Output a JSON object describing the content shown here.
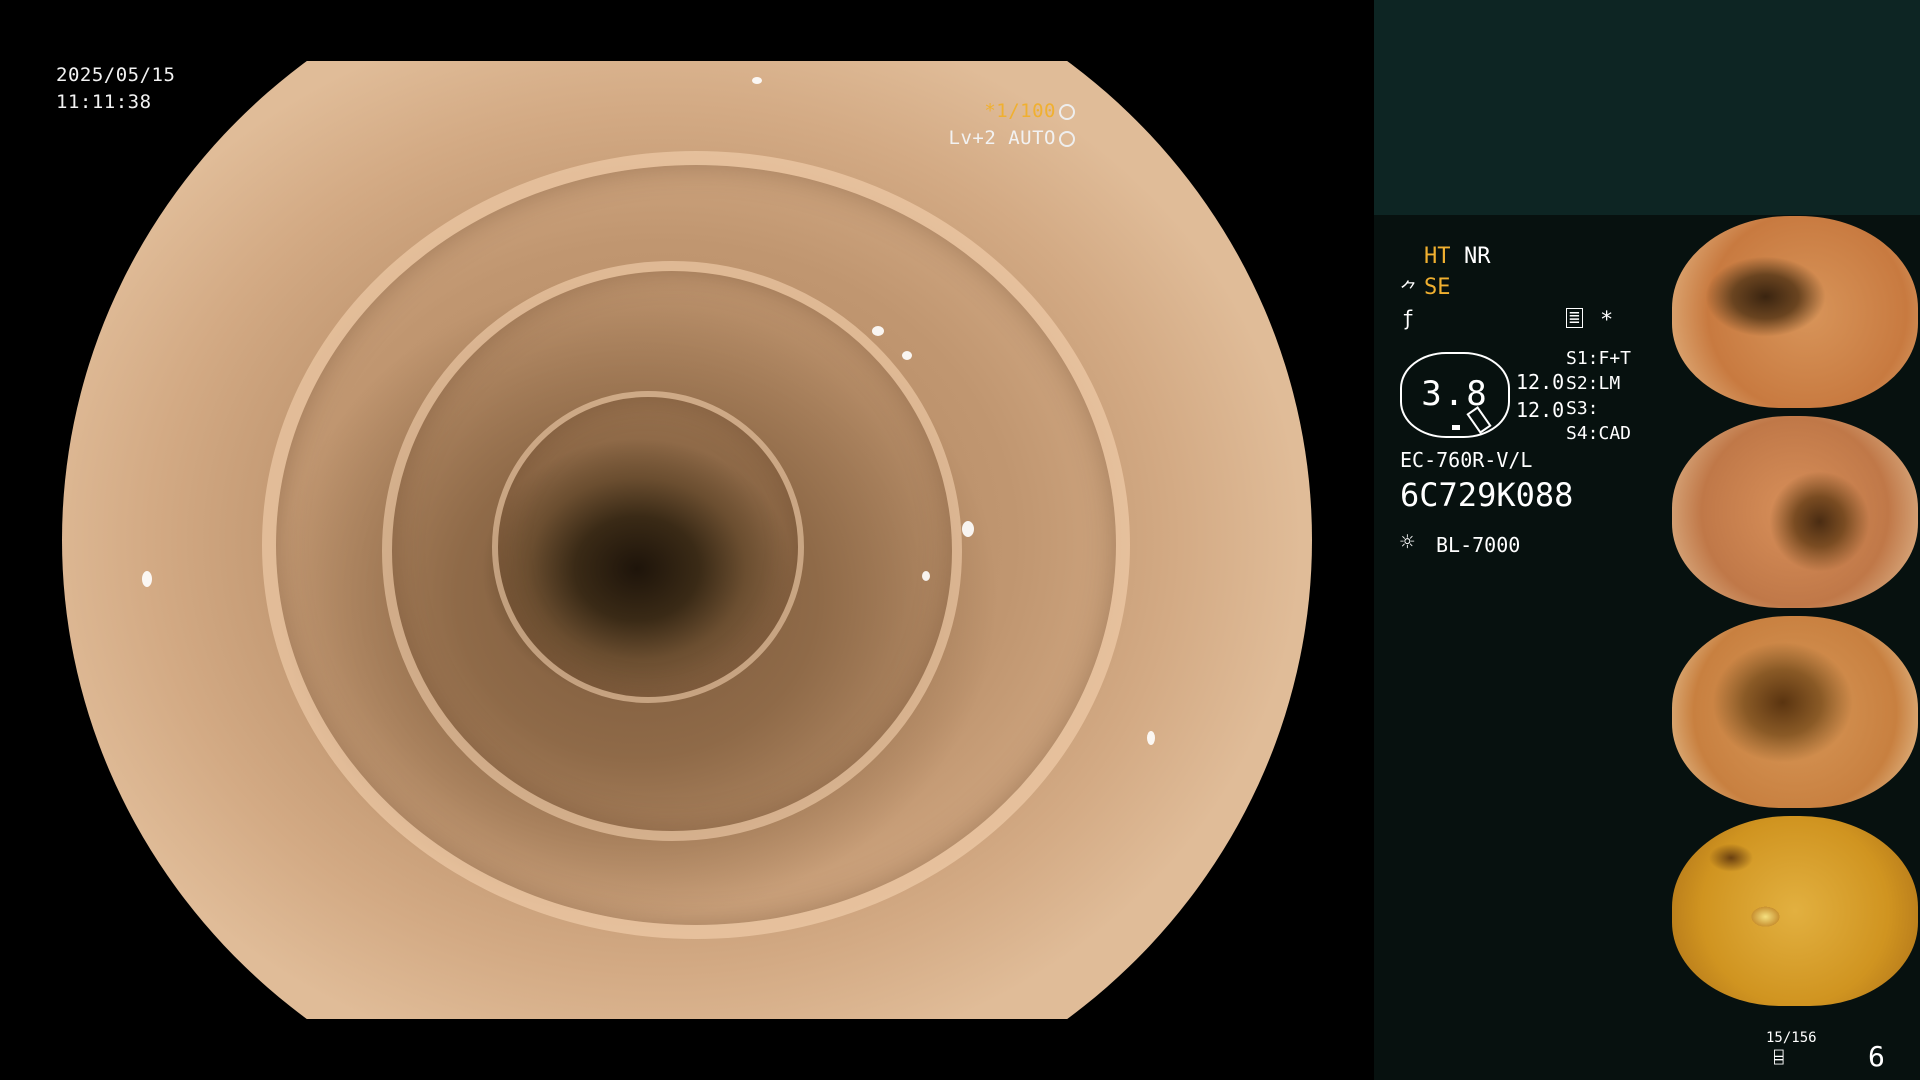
{
  "osd": {
    "date": "2025/05/15",
    "time": "11:11:38",
    "shutter": "*1/100",
    "level": "Lv+2 AUTO"
  },
  "panel": {
    "ht": "HT",
    "nr": "NR",
    "se": "SE",
    "mode_icon": "*",
    "gauge_value": "3.8",
    "gauge_left_top": "12.0",
    "gauge_left_bottom": "12.0",
    "s1": "S1:F+T",
    "s2": "S2:LM",
    "s3": "S3:",
    "s4": "S4:CAD",
    "scope_model": "EC-760R-V/L",
    "serial": "6C729K088",
    "light_source": "BL-7000",
    "image_counter": "15/156",
    "page_number": "6"
  },
  "icons": [
    "structure-enhance-icon",
    "filter-icon",
    "menu-icon",
    "light-source-icon",
    "storage-icon",
    "aperture-icon"
  ]
}
